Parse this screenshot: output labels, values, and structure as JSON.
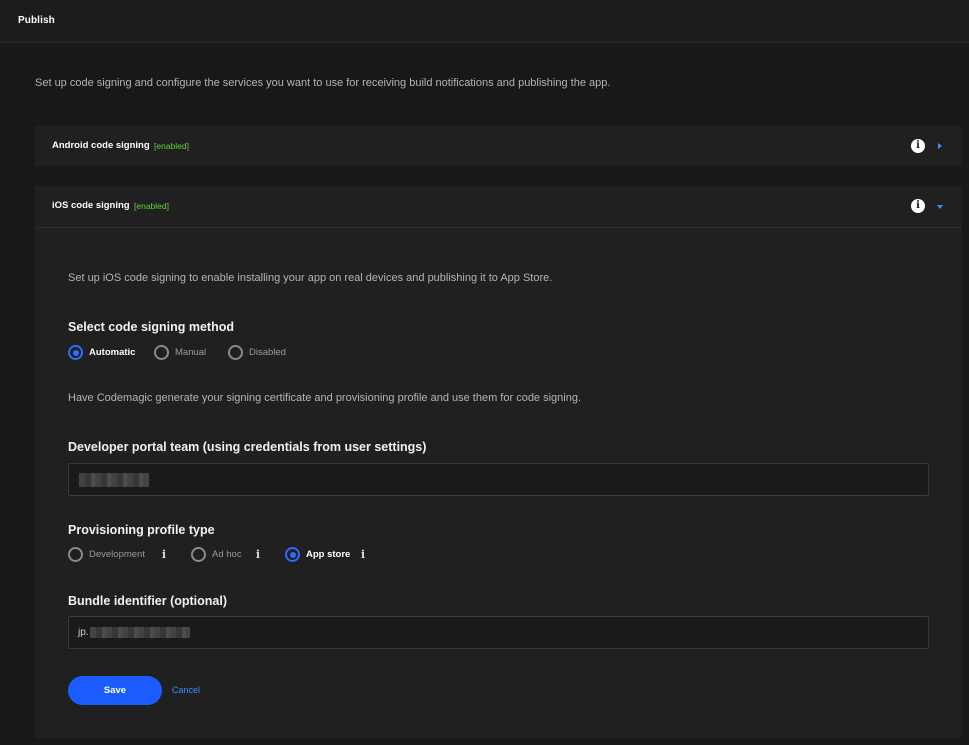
{
  "header": {
    "title": "Publish"
  },
  "intro": "Set up code signing and configure the services you want to use for receiving build notifications and publishing the app.",
  "android": {
    "title": "Android code signing",
    "badge": "[enabled]",
    "info_icon": "info-icon",
    "chevron_icon": "chevron-right-icon"
  },
  "ios": {
    "title": "iOS code signing",
    "badge": "[enabled]",
    "info_icon": "info-icon",
    "chevron_icon": "chevron-down-icon",
    "description": "Set up iOS code signing to enable installing your app on real devices and publishing it to App Store.",
    "method": {
      "label": "Select code signing method",
      "options": [
        "Automatic",
        "Manual",
        "Disabled"
      ],
      "selected": "Automatic"
    },
    "method_description": "Have Codemagic generate your signing certificate and provisioning profile and use them for code signing.",
    "team": {
      "label": "Developer portal team (using credentials from user settings)",
      "value": "(redacted)"
    },
    "profile": {
      "label": "Provisioning profile type",
      "options": [
        "Development",
        "Ad hoc",
        "App store"
      ],
      "selected": "App store"
    },
    "bundle": {
      "label": "Bundle identifier (optional)",
      "prefix": "jp."
    },
    "actions": {
      "save": "Save",
      "cancel": "Cancel"
    }
  },
  "colors": {
    "background": "#181818",
    "card": "#202020",
    "accent": "#1a5cff",
    "link": "#3a8cff",
    "enabled": "#5fd33b"
  }
}
